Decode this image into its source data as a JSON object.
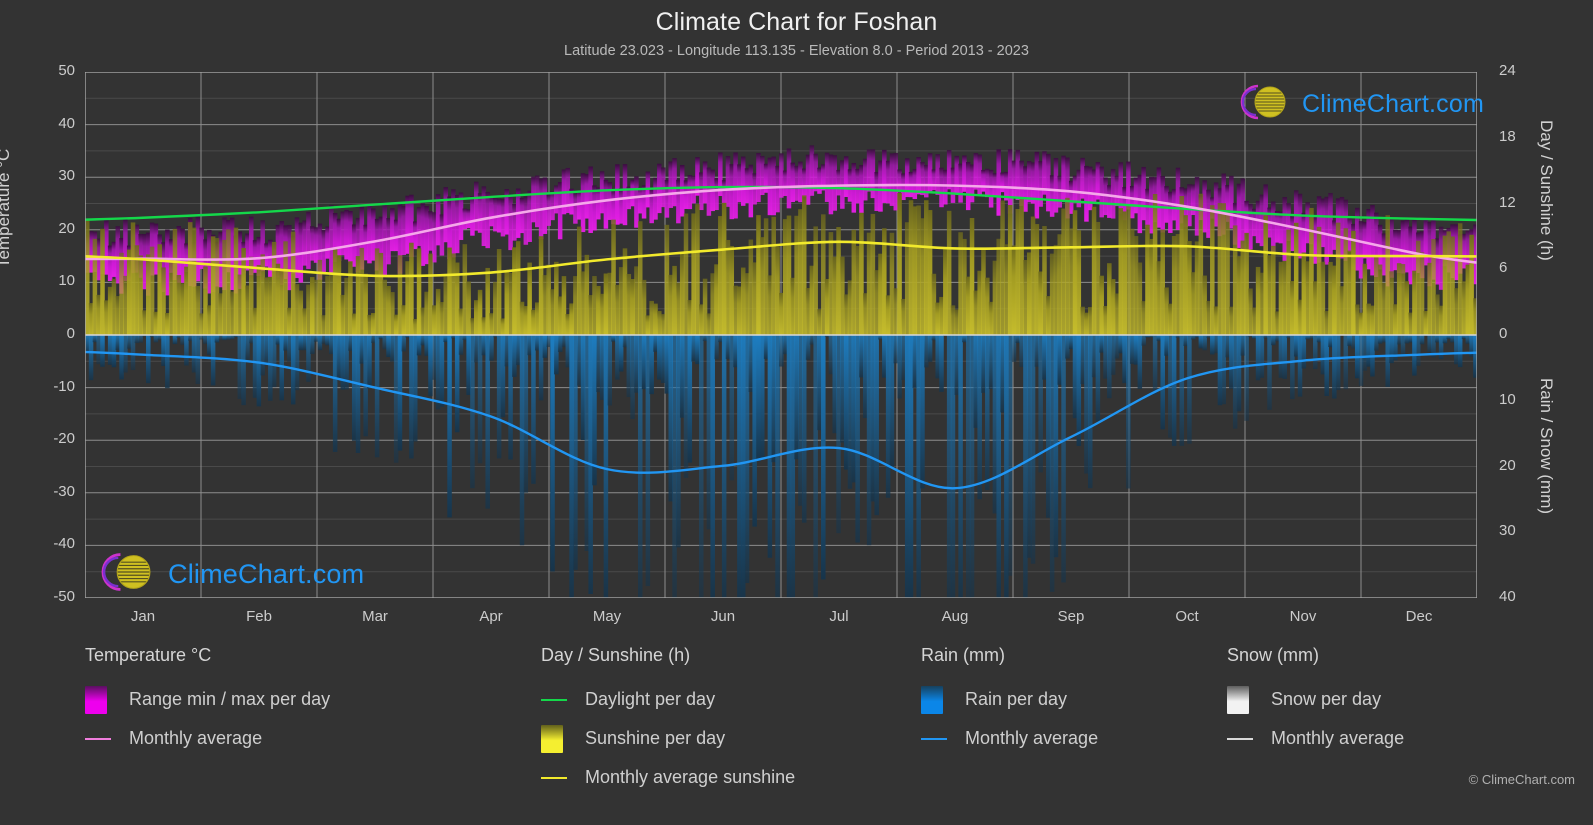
{
  "header": {
    "title": "Climate Chart for Foshan",
    "subtitle": "Latitude 23.023 - Longitude 113.135 - Elevation 8.0 - Period 2013 - 2023"
  },
  "footer": {
    "copyright": "© ClimeChart.com"
  },
  "watermark": {
    "text": "ClimeChart.com"
  },
  "axes": {
    "left_title": "Temperature °C",
    "right_top_title": "Day / Sunshine (h)",
    "right_bottom_title": "Rain / Snow (mm)",
    "left_ticks": [
      "50",
      "40",
      "30",
      "20",
      "10",
      "0",
      "-10",
      "-20",
      "-30",
      "-40",
      "-50"
    ],
    "right_top_ticks": [
      "24",
      "18",
      "12",
      "6",
      "0"
    ],
    "right_bottom_ticks": [
      "0",
      "10",
      "20",
      "30",
      "40"
    ],
    "x_ticks": [
      "Jan",
      "Feb",
      "Mar",
      "Apr",
      "May",
      "Jun",
      "Jul",
      "Aug",
      "Sep",
      "Oct",
      "Nov",
      "Dec"
    ]
  },
  "legend": {
    "groups": [
      {
        "title": "Temperature °C",
        "items": [
          {
            "label": "Range min / max per day",
            "key": "swatch",
            "color": "#ee00ee",
            "color2": "#5a1060"
          },
          {
            "label": "Monthly average",
            "key": "line",
            "color": "#f07ddd"
          }
        ]
      },
      {
        "title": "Day / Sunshine (h)",
        "items": [
          {
            "label": "Daylight per day",
            "key": "line",
            "color": "#14d84a"
          },
          {
            "label": "Sunshine per day",
            "key": "swatch",
            "color": "#f5ef30",
            "color2": "#61601b"
          },
          {
            "label": "Monthly average sunshine",
            "key": "line",
            "color": "#f2ea2c"
          }
        ]
      },
      {
        "title": "Rain (mm)",
        "items": [
          {
            "label": "Rain per day",
            "key": "swatch",
            "color": "#0b86e8",
            "color2": "#16415e"
          },
          {
            "label": "Monthly average",
            "key": "line",
            "color": "#2196f3"
          }
        ]
      },
      {
        "title": "Snow (mm)",
        "items": [
          {
            "label": "Snow per day",
            "key": "swatch",
            "color": "#f2f2f2",
            "color2": "#5e5e5e"
          },
          {
            "label": "Monthly average",
            "key": "line",
            "color": "#d9d9d9"
          }
        ]
      }
    ]
  },
  "chart_data": {
    "type": "line",
    "title": "Climate Chart for Foshan",
    "subtitle": "Latitude 23.023 - Longitude 113.135 - Elevation 8.0 - Period 2013 - 2023",
    "xlabel": "",
    "ylabel": "Temperature °C",
    "y2label_top": "Day / Sunshine (h)",
    "y2label_bottom": "Rain / Snow (mm)",
    "ylim": [
      -50,
      50
    ],
    "y2lim_top": [
      0,
      24
    ],
    "y2lim_bottom": [
      0,
      40
    ],
    "grid": true,
    "legend_position": "below",
    "categories": [
      "Jan",
      "Feb",
      "Mar",
      "Apr",
      "May",
      "Jun",
      "Jul",
      "Aug",
      "Sep",
      "Oct",
      "Nov",
      "Dec"
    ],
    "series": [
      {
        "name": "Monthly average temperature",
        "unit": "°C",
        "color": "#f07ddd",
        "axis": "left",
        "values": [
          14.5,
          14.6,
          17.8,
          22.3,
          25.6,
          27.6,
          28.4,
          28.4,
          27.3,
          24.4,
          20.1,
          15.4
        ]
      },
      {
        "name": "Daylight per day",
        "unit": "h",
        "color": "#14d84a",
        "axis": "right-top",
        "values": [
          10.7,
          11.2,
          11.9,
          12.6,
          13.2,
          13.5,
          13.4,
          12.9,
          12.2,
          11.5,
          10.9,
          10.6
        ]
      },
      {
        "name": "Monthly average sunshine",
        "unit": "h",
        "color": "#f2ea2c",
        "axis": "right-top",
        "values": [
          6.9,
          6.1,
          5.4,
          5.7,
          6.9,
          7.8,
          8.5,
          7.9,
          8.0,
          8.1,
          7.3,
          7.2
        ]
      },
      {
        "name": "Monthly average rain",
        "unit": "mm",
        "color": "#2196f3",
        "axis": "right-bottom",
        "values": [
          3.0,
          4.2,
          8.0,
          12.4,
          20.4,
          19.9,
          17.2,
          23.3,
          15.5,
          6.6,
          3.9,
          3.0
        ]
      },
      {
        "name": "Range min / max per day",
        "unit": "°C",
        "color": "#ee00ee",
        "axis": "left",
        "min_values": [
          10.0,
          10.5,
          13.5,
          18.5,
          22.0,
          24.5,
          25.5,
          25.5,
          24.0,
          20.5,
          15.5,
          11.0
        ],
        "max_values": [
          19.5,
          20.0,
          23.0,
          27.0,
          30.0,
          32.0,
          33.5,
          33.5,
          32.0,
          29.0,
          25.0,
          20.5
        ]
      },
      {
        "name": "Sunshine per day",
        "unit": "h",
        "color": "#f5ef30",
        "axis": "right-top",
        "values": [
          6.9,
          6.1,
          5.4,
          5.7,
          6.9,
          7.8,
          8.5,
          7.9,
          8.0,
          8.1,
          7.3,
          7.2
        ]
      },
      {
        "name": "Rain per day",
        "unit": "mm",
        "color": "#0b86e8",
        "axis": "right-bottom",
        "values": [
          3.0,
          4.2,
          8.0,
          12.4,
          20.4,
          19.9,
          17.2,
          23.3,
          15.5,
          6.6,
          3.9,
          3.0
        ]
      },
      {
        "name": "Snow per day",
        "unit": "mm",
        "color": "#f2f2f2",
        "axis": "right-bottom",
        "values": [
          0,
          0,
          0,
          0,
          0,
          0,
          0,
          0,
          0,
          0,
          0,
          0
        ]
      }
    ]
  }
}
